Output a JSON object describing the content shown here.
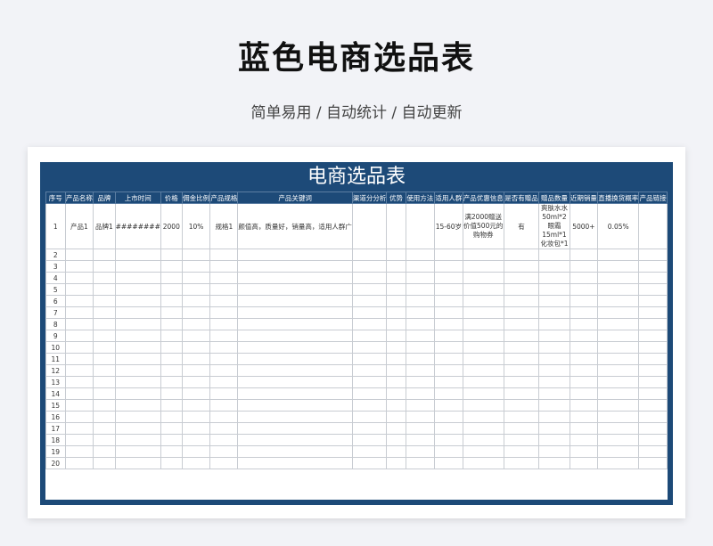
{
  "page": {
    "title": "蓝色电商选品表",
    "subtitle": "简单易用  /  自动统计  /  自动更新"
  },
  "sheet": {
    "title": "电商选品表",
    "headers": [
      "序号",
      "产品名称",
      "品牌",
      "上市时间",
      "价格",
      "佣金比例",
      "产品规格",
      "产品关键词",
      "渠道分分析",
      "优势",
      "使用方法",
      "适用人群",
      "产品优惠信息",
      "是否有赠品",
      "赠品数量",
      "近期销量",
      "直播换货概率",
      "产品链接"
    ],
    "row1": {
      "no": "1",
      "name": "产品1",
      "brand": "品牌1",
      "launch": "########",
      "price": "2000",
      "commission": "10%",
      "spec": "规格1",
      "keywords": "颜值高，质量好，销量高，适用人群广",
      "channel": "",
      "advantage": "",
      "usage": "",
      "audience": "15-60岁",
      "promo": "满2000赠送价值500元的购物券",
      "has_gift": "有",
      "gift_qty": "爽肤水水50ml*2眼霜15ml*1化妆包*1",
      "sales": "5000+",
      "swap_rate": "0.05%",
      "link": ""
    },
    "empty_rows": [
      "2",
      "3",
      "4",
      "5",
      "6",
      "7",
      "8",
      "9",
      "10",
      "11",
      "12",
      "13",
      "14",
      "15",
      "16",
      "17",
      "18",
      "19",
      "20"
    ]
  }
}
